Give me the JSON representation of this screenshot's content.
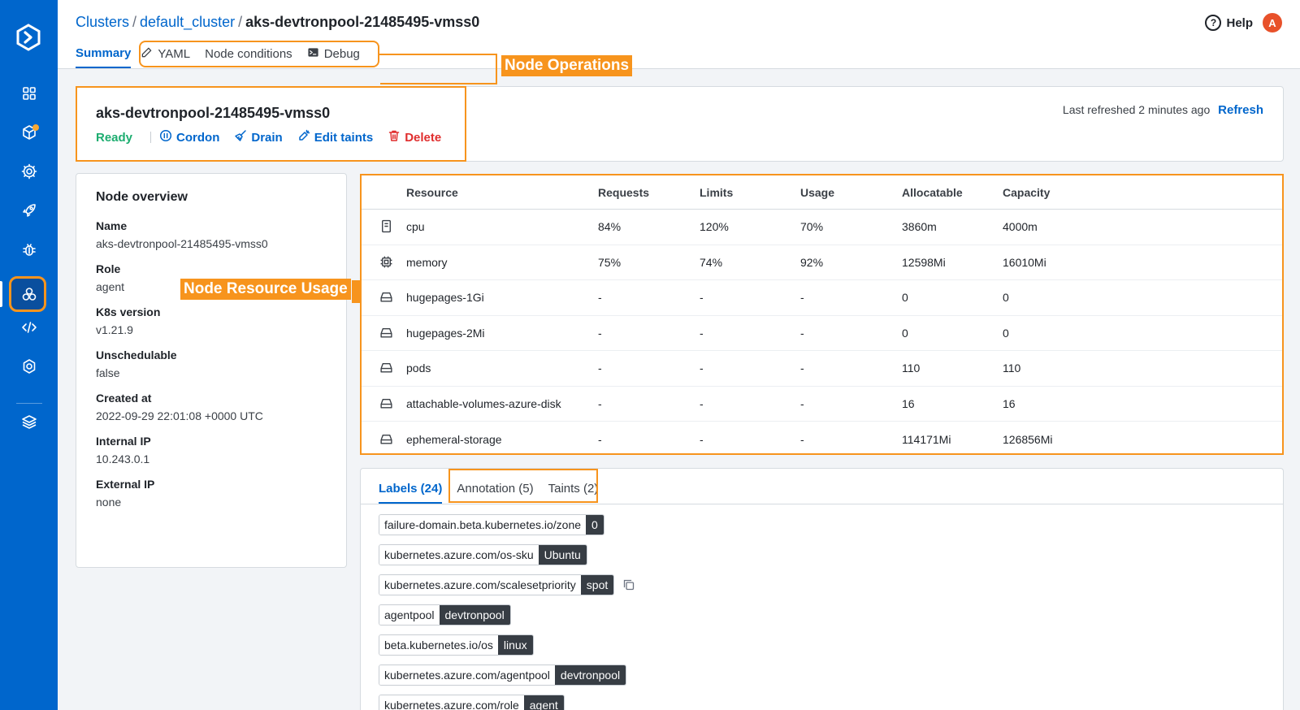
{
  "breadcrumb": {
    "clusters": "Clusters",
    "sep1": "/",
    "cluster": "default_cluster",
    "sep2": "/",
    "node": "aks-devtronpool-21485495-vmss0"
  },
  "header": {
    "help_label": "Help",
    "help_icon_char": "?",
    "avatar_initial": "A"
  },
  "tabs": [
    {
      "label": "Summary"
    },
    {
      "label": "YAML"
    },
    {
      "label": "Node conditions"
    },
    {
      "label": "Debug"
    }
  ],
  "annotations": {
    "node_operations": "Node Operations",
    "node_resource_usage": "Node Resource Usage"
  },
  "node": {
    "name": "aks-devtronpool-21485495-vmss0",
    "status": "Ready",
    "actions": {
      "cordon": "Cordon",
      "drain": "Drain",
      "edit_taints": "Edit taints",
      "delete": "Delete"
    },
    "last_refreshed": "Last refreshed 2 minutes ago",
    "refresh": "Refresh"
  },
  "overview": {
    "title": "Node overview",
    "fields": [
      {
        "label": "Name",
        "value": "aks-devtronpool-21485495-vmss0"
      },
      {
        "label": "Role",
        "value": "agent"
      },
      {
        "label": "K8s version",
        "value": "v1.21.9"
      },
      {
        "label": "Unschedulable",
        "value": "false"
      },
      {
        "label": "Created at",
        "value": "2022-09-29 22:01:08 +0000 UTC"
      },
      {
        "label": "Internal IP",
        "value": "10.243.0.1"
      },
      {
        "label": "External IP",
        "value": "none"
      }
    ]
  },
  "resources": {
    "columns": [
      "Resource",
      "Requests",
      "Limits",
      "Usage",
      "Allocatable",
      "Capacity"
    ],
    "rows": [
      {
        "icon": "cpu-icon",
        "resource": "cpu",
        "requests": "84%",
        "limits": "120%",
        "usage": "70%",
        "allocatable": "3860m",
        "capacity": "4000m"
      },
      {
        "icon": "memory-chip-icon",
        "resource": "memory",
        "requests": "75%",
        "limits": "74%",
        "usage": "92%",
        "allocatable": "12598Mi",
        "capacity": "16010Mi"
      },
      {
        "icon": "storage-icon",
        "resource": "hugepages-1Gi",
        "requests": "-",
        "limits": "-",
        "usage": "-",
        "allocatable": "0",
        "capacity": "0"
      },
      {
        "icon": "storage-icon",
        "resource": "hugepages-2Mi",
        "requests": "-",
        "limits": "-",
        "usage": "-",
        "allocatable": "0",
        "capacity": "0"
      },
      {
        "icon": "storage-icon",
        "resource": "pods",
        "requests": "-",
        "limits": "-",
        "usage": "-",
        "allocatable": "110",
        "capacity": "110"
      },
      {
        "icon": "storage-icon",
        "resource": "attachable-volumes-azure-disk",
        "requests": "-",
        "limits": "-",
        "usage": "-",
        "allocatable": "16",
        "capacity": "16"
      },
      {
        "icon": "storage-icon",
        "resource": "ephemeral-storage",
        "requests": "-",
        "limits": "-",
        "usage": "-",
        "allocatable": "114171Mi",
        "capacity": "126856Mi"
      }
    ]
  },
  "label_tabs": [
    {
      "label": "Labels (24)"
    },
    {
      "label": "Annotation (5)"
    },
    {
      "label": "Taints (2)"
    }
  ],
  "labels": [
    {
      "key": "failure-domain.beta.kubernetes.io/zone",
      "value": "0"
    },
    {
      "key": "kubernetes.azure.com/os-sku",
      "value": "Ubuntu"
    },
    {
      "key": "kubernetes.azure.com/scalesetpriority",
      "value": "spot"
    },
    {
      "key": "agentpool",
      "value": "devtronpool"
    },
    {
      "key": "beta.kubernetes.io/os",
      "value": "linux"
    },
    {
      "key": "kubernetes.azure.com/agentpool",
      "value": "devtronpool"
    },
    {
      "key": "kubernetes.azure.com/role",
      "value": "agent"
    }
  ],
  "colors": {
    "sidebar": "#0066cc",
    "accent": "#0066cc",
    "highlight": "#f7941d",
    "ready": "#1dad70",
    "danger": "#e02d2d"
  }
}
